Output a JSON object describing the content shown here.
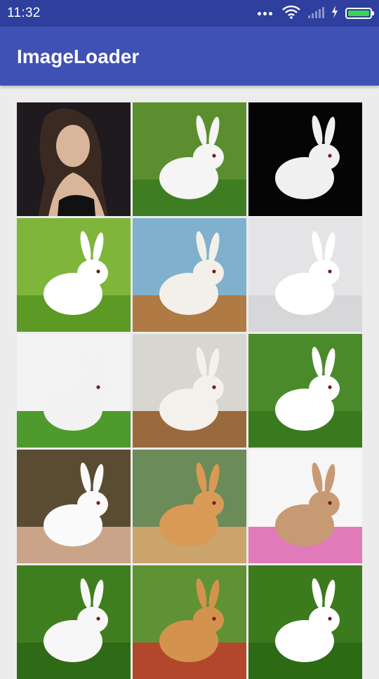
{
  "status_bar": {
    "time": "11:32",
    "icons": [
      "more-dots-icon",
      "wifi-icon",
      "signal-icon",
      "charging-icon",
      "battery-icon"
    ],
    "battery_color": "#3cd35a",
    "background": "#2f3f9e"
  },
  "app_bar": {
    "title": "ImageLoader",
    "background": "#3f51b5"
  },
  "grid": {
    "columns": 3,
    "items": [
      {
        "name": "image-woman-portrait",
        "bg": "#1e1a1d",
        "ground": "#2a2226",
        "animal": "#d9b69a"
      },
      {
        "name": "image-rabbit-carrot",
        "bg": "#5b8e2e",
        "ground": "#3f7d22",
        "animal": "#f5f5f5"
      },
      {
        "name": "image-rabbit-black-background",
        "bg": "#050505",
        "ground": "#050505",
        "animal": "#f0f0f0"
      },
      {
        "name": "image-rabbit-grass",
        "bg": "#7fb53b",
        "ground": "#5c9a25",
        "animal": "#ffffff"
      },
      {
        "name": "image-rabbit-blue-wood-eggs",
        "bg": "#7fb1cf",
        "ground": "#b07a45",
        "animal": "#f3f0ea"
      },
      {
        "name": "image-rabbit-grey-background",
        "bg": "#e4e4e6",
        "ground": "#d7d7da",
        "animal": "#ffffff"
      },
      {
        "name": "image-rabbit-lettuce",
        "bg": "#f3f3f3",
        "ground": "#4f9a2c",
        "animal": "#f2f2f2"
      },
      {
        "name": "image-rabbit-basket",
        "bg": "#d8d6d0",
        "ground": "#9a6a3e",
        "animal": "#f4f1ec"
      },
      {
        "name": "image-rabbit-green-field",
        "bg": "#4b8a2a",
        "ground": "#3a7a1f",
        "animal": "#ffffff"
      },
      {
        "name": "image-rabbit-hand",
        "bg": "#5a4c33",
        "ground": "#c9a489",
        "animal": "#fafafa"
      },
      {
        "name": "image-lop-rabbit-flowers",
        "bg": "#6b8b58",
        "ground": "#caa46b",
        "animal": "#d99a56"
      },
      {
        "name": "image-rabbit-easter-basket",
        "bg": "#f6f6f6",
        "ground": "#e07ab9",
        "animal": "#c89a73"
      },
      {
        "name": "image-rabbits-grass-pair",
        "bg": "#3f7e1f",
        "ground": "#2f6b16",
        "animal": "#f7f7f7"
      },
      {
        "name": "image-rabbit-flowerpot",
        "bg": "#5e9235",
        "ground": "#b2472b",
        "animal": "#d4924f"
      },
      {
        "name": "image-rabbits-white-pair",
        "bg": "#3b7a1d",
        "ground": "#2c6a14",
        "animal": "#ffffff"
      }
    ]
  }
}
